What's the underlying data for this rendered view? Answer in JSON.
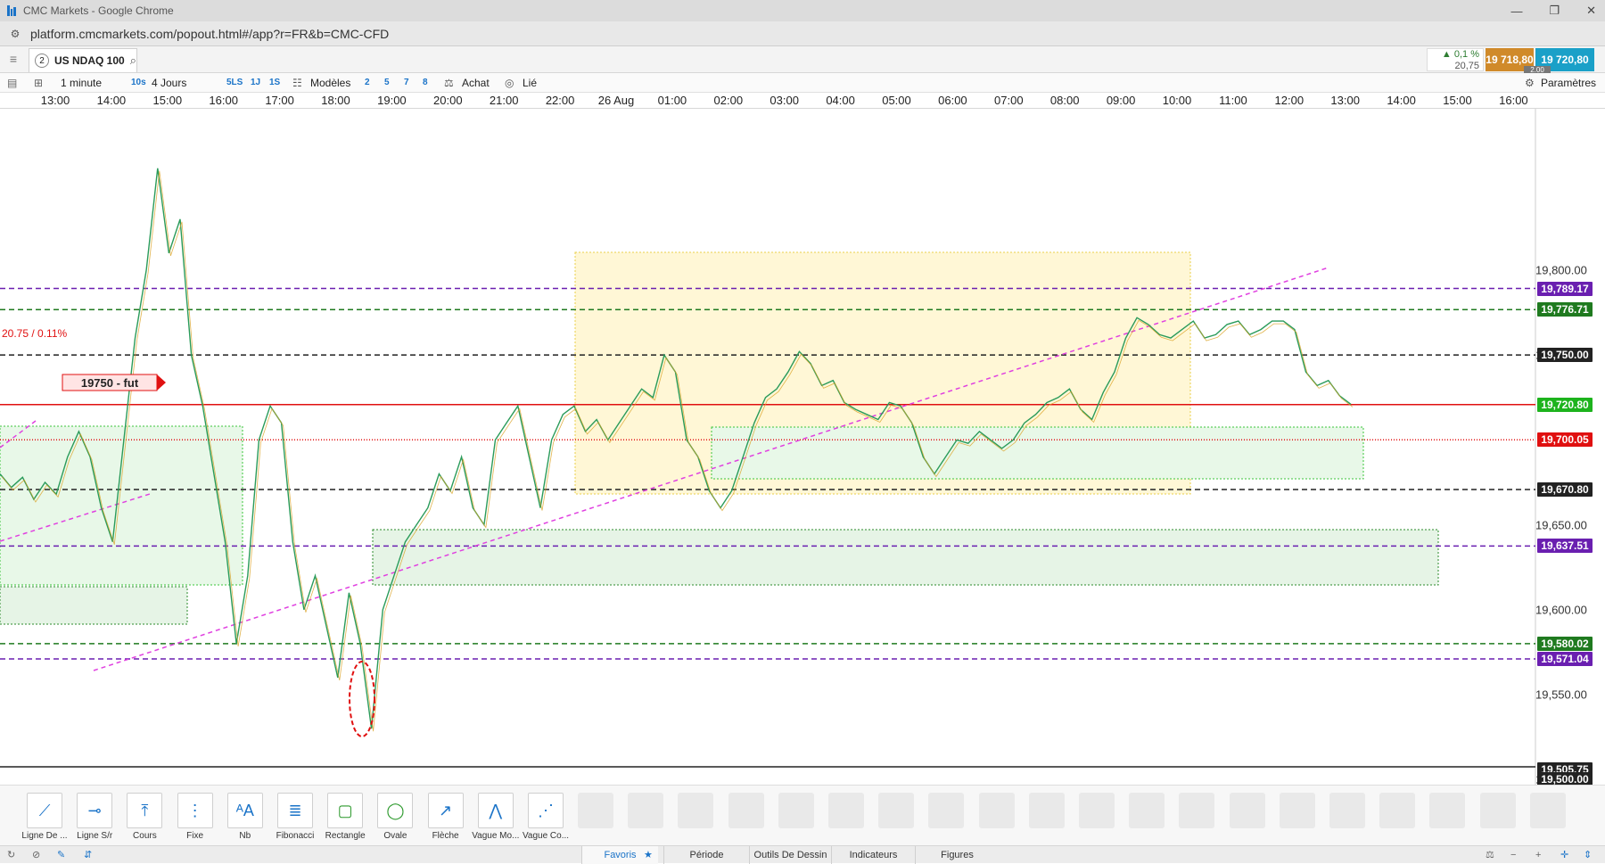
{
  "window": {
    "title": "CMC Markets - Google Chrome",
    "controls": [
      "—",
      "❐",
      "✕"
    ]
  },
  "browser": {
    "url": "platform.cmcmarkets.com/popout.html#/app?r=FR&b=CMC-CFD"
  },
  "instrument": {
    "tab_number": "2",
    "name": "US NDAQ 100"
  },
  "quote": {
    "change_pct": "0,1 %",
    "change_abs": "20,75",
    "sell": "19 718,80",
    "buy": "19 720,80",
    "spread": "2.00"
  },
  "toolbar": {
    "interval": "1 minute",
    "interval_quick": [
      "10s"
    ],
    "range": "4 Jours",
    "range_quick": [
      "5LS",
      "1J",
      "1S"
    ],
    "models": "Modèles",
    "grid_quick": [
      "2",
      "5",
      "7",
      "8"
    ],
    "buy": "Achat",
    "linked": "Lié",
    "settings": "Paramètres"
  },
  "time_axis": [
    "13:00",
    "14:00",
    "15:00",
    "16:00",
    "17:00",
    "18:00",
    "19:00",
    "20:00",
    "21:00",
    "22:00",
    "26 Aug",
    "01:00",
    "02:00",
    "03:00",
    "04:00",
    "05:00",
    "06:00",
    "07:00",
    "08:00",
    "09:00",
    "10:00",
    "11:00",
    "12:00",
    "13:00",
    "14:00",
    "15:00",
    "16:00"
  ],
  "price_axis": {
    "ticks": [
      "19,800.00",
      "19,750.00",
      "19,650.00",
      "19,600.00",
      "19,550.00",
      "19,500.00"
    ],
    "tags": [
      {
        "label": "19,789.17",
        "color": "#6a1fb0"
      },
      {
        "label": "19,776.71",
        "color": "#1f7a1f"
      },
      {
        "label": "19,750.00",
        "color": "#222222"
      },
      {
        "label": "19,720.80",
        "color": "#1db31d"
      },
      {
        "label": "19,700.05",
        "color": "#e01010"
      },
      {
        "label": "19,670.80",
        "color": "#222222"
      },
      {
        "label": "19,637.51",
        "color": "#6a1fb0"
      },
      {
        "label": "19,580.02",
        "color": "#1f7a1f"
      },
      {
        "label": "19,571.04",
        "color": "#6a1fb0"
      },
      {
        "label": "19,505.75",
        "color": "#222222"
      },
      {
        "label": "19,500.00",
        "color": "#222222"
      }
    ]
  },
  "annotations": {
    "prev_close": "20.75 / 0.11%",
    "fut_label": "19750 - fut"
  },
  "chart_data": {
    "type": "line",
    "symbol": "US NDAQ 100",
    "interval": "1 minute",
    "x_ticks": [
      "13:00",
      "14:00",
      "15:00",
      "16:00",
      "17:00",
      "18:00",
      "19:00",
      "20:00",
      "21:00",
      "22:00",
      "26 Aug",
      "01:00",
      "02:00",
      "03:00",
      "04:00",
      "05:00",
      "06:00",
      "07:00",
      "08:00",
      "09:00",
      "10:00",
      "11:00",
      "12:00",
      "13:00"
    ],
    "y_ticks": [
      19800,
      19750,
      19650,
      19600,
      19550,
      19500
    ],
    "ylim": [
      19497,
      19895
    ],
    "series": [
      {
        "values": [
          19680,
          19672,
          19678,
          19665,
          19675,
          19668,
          19690,
          19705,
          19690,
          19660,
          19640,
          19700,
          19760,
          19800,
          19860,
          19810,
          19830,
          19750,
          19720,
          19680,
          19640,
          19580,
          19620,
          19700,
          19720,
          19710,
          19640,
          19600,
          19620,
          19590,
          19560,
          19610,
          19580,
          19530,
          19600,
          19620,
          19640,
          19650,
          19660,
          19680,
          19670,
          19690,
          19660,
          19650,
          19700,
          19710,
          19720,
          19690,
          19660,
          19700,
          19715,
          19720,
          19705,
          19712,
          19700,
          19710,
          19720,
          19730,
          19725,
          19750,
          19740,
          19700,
          19690,
          19670,
          19660,
          19670,
          19690,
          19710,
          19725,
          19730,
          19740,
          19752,
          19745,
          19732,
          19735,
          19722,
          19718,
          19715,
          19712,
          19722,
          19720,
          19710,
          19690,
          19680,
          19690,
          19700,
          19698,
          19705,
          19700,
          19695,
          19700,
          19710,
          19715,
          19722,
          19725,
          19730,
          19718,
          19712,
          19728,
          19740,
          19760,
          19772,
          19768,
          19762,
          19760,
          19765,
          19770,
          19760,
          19762,
          19768,
          19770,
          19762,
          19765,
          19770,
          19770,
          19765,
          19740,
          19732,
          19735,
          19726,
          19721
        ]
      }
    ],
    "levels": [
      19789.17,
      19776.71,
      19750.0,
      19720.8,
      19700.05,
      19670.8,
      19637.51,
      19580.02,
      19571.04
    ]
  },
  "drawing_tools": [
    {
      "label": "Ligne De ...",
      "icon": "line-tool-icon"
    },
    {
      "label": "Ligne S/r",
      "icon": "support-resistance-icon"
    },
    {
      "label": "Cours",
      "icon": "price-icon"
    },
    {
      "label": "Fixe",
      "icon": "fixed-icon"
    },
    {
      "label": "Nb",
      "icon": "text-icon"
    },
    {
      "label": "Fibonacci",
      "icon": "fibonacci-icon"
    },
    {
      "label": "Rectangle",
      "icon": "rectangle-icon"
    },
    {
      "label": "Ovale",
      "icon": "oval-icon"
    },
    {
      "label": "Flèche",
      "icon": "arrow-icon"
    },
    {
      "label": "Vague Mo...",
      "icon": "wave-icon"
    },
    {
      "label": "Vague Co...",
      "icon": "wave-corrective-icon"
    }
  ],
  "status_tabs": [
    "Favoris",
    "Période",
    "Outils De Dessin",
    "Indicateurs",
    "Figures"
  ]
}
